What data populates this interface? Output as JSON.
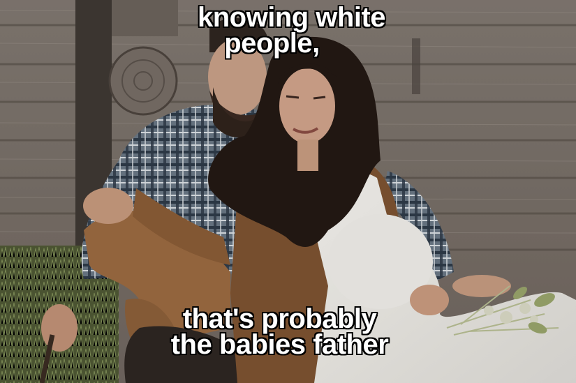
{
  "meme": {
    "top_text": [
      "knowing white",
      "people,"
    ],
    "bottom_text": [
      "that's probably",
      "the babies father"
    ]
  },
  "photo": {
    "subject": "pregnant-couple-photo",
    "colors": {
      "wood": "#8a8178",
      "wood_dark": "#5f574f",
      "shirt_plaid": "#5b6774",
      "pants_tan": "#9a6a41",
      "vest_brown": "#7d5331",
      "dress_white": "#f1efea",
      "skin": "#c79b80",
      "hair": "#231914",
      "grass": "#5f6c3f"
    }
  }
}
